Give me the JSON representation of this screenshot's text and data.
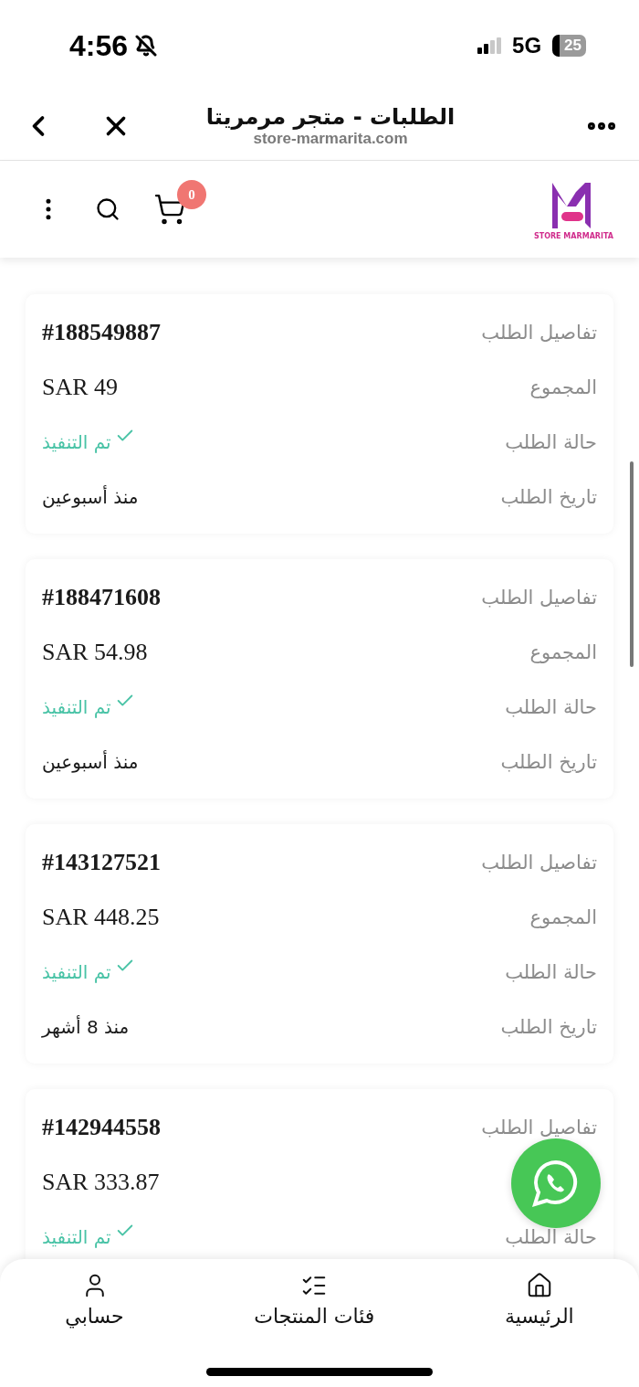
{
  "status_bar": {
    "time": "4:56",
    "network": "5G",
    "battery": "25"
  },
  "browser_bar": {
    "title": "الطلبات - متجر مرمريتا",
    "url": "store-marmarita.com"
  },
  "site_header": {
    "logo_text": "STORE MARMARITA",
    "cart_count": "0"
  },
  "orders": [
    {
      "rows": [
        {
          "kind": "id",
          "label": "تفاصيل الطلب",
          "value": "#188549887"
        },
        {
          "kind": "amount",
          "label": "المجموع",
          "value": "SAR 49"
        },
        {
          "kind": "status",
          "label": "حالة الطلب",
          "value": "تم التنفيذ"
        },
        {
          "kind": "date",
          "label": "تاريخ الطلب",
          "value": "منذ أسبوعين"
        }
      ]
    },
    {
      "rows": [
        {
          "kind": "id",
          "label": "تفاصيل الطلب",
          "value": "#188471608"
        },
        {
          "kind": "amount",
          "label": "المجموع",
          "value": "SAR 54.98"
        },
        {
          "kind": "status",
          "label": "حالة الطلب",
          "value": "تم التنفيذ"
        },
        {
          "kind": "date",
          "label": "تاريخ الطلب",
          "value": "منذ أسبوعين"
        }
      ]
    },
    {
      "rows": [
        {
          "kind": "id",
          "label": "تفاصيل الطلب",
          "value": "#143127521"
        },
        {
          "kind": "amount",
          "label": "المجموع",
          "value": "SAR 448.25"
        },
        {
          "kind": "status",
          "label": "حالة الطلب",
          "value": "تم التنفيذ"
        },
        {
          "kind": "date",
          "label": "تاريخ الطلب",
          "value": "منذ 8 أشهر"
        }
      ]
    },
    {
      "rows": [
        {
          "kind": "id",
          "label": "تفاصيل الطلب",
          "value": "#142944558"
        },
        {
          "kind": "amount",
          "value": "SAR 333.87"
        },
        {
          "kind": "status",
          "label": "حالة الطلب",
          "value": "تم التنفيذ"
        }
      ]
    }
  ],
  "bottom_nav": [
    {
      "label": "الرئيسية"
    },
    {
      "label": "فئات المنتجات"
    },
    {
      "label": "حسابي"
    }
  ]
}
